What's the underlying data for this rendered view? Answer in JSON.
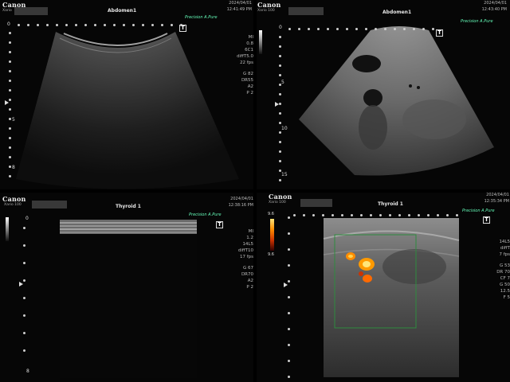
{
  "q1": {
    "brand": "Canon",
    "model": "Xario",
    "exam": "Abdomen1",
    "date": "2024/04/01",
    "time": "12:41:49 PM",
    "precision": "Precision",
    "apure": "A.Pure",
    "tmark": "T",
    "depth_labels": [
      "0",
      "5",
      "8"
    ],
    "params": [
      "MI",
      "0.8",
      "6C1",
      "diffT5.0",
      "22 fps",
      "G 82",
      "DR55",
      "A2",
      "P 2"
    ]
  },
  "q2": {
    "brand": "Canon",
    "model": "Xario 100",
    "exam": "Abdomen1",
    "date": "2024/04/01",
    "time": "12:43:40 PM",
    "precision": "Precision",
    "apure": "A.Pure",
    "tmark": "T",
    "depth_labels": [
      "0",
      "5",
      "10",
      "15"
    ]
  },
  "q3": {
    "brand": "Canon",
    "model": "Xario 100",
    "exam": "Thyroid 1",
    "date": "2024/04/01",
    "time": "12:38:16 PM",
    "precision": "Precision",
    "apure": "A.Pure",
    "tmark": "T",
    "depth_labels": [
      "0",
      "8"
    ],
    "params": [
      "MI",
      "1.2",
      "14L5",
      "diffT10",
      "17 fps",
      "G 67",
      "DR70",
      "A2",
      "P 2"
    ]
  },
  "q4": {
    "brand": "Canon",
    "model": "Xario 100",
    "exam": "Thyroid 1",
    "date": "2024/04/01",
    "time": "12:35:34 PM",
    "precision": "Precision",
    "apure": "A.Pure",
    "tmark": "T",
    "color_scale": [
      "9.6",
      "9.6"
    ],
    "params": [
      "14L5",
      "diffT",
      "7 fps",
      "G 53",
      "DR 70",
      "CF 7",
      "G 50",
      "12.5",
      "F 5"
    ]
  }
}
